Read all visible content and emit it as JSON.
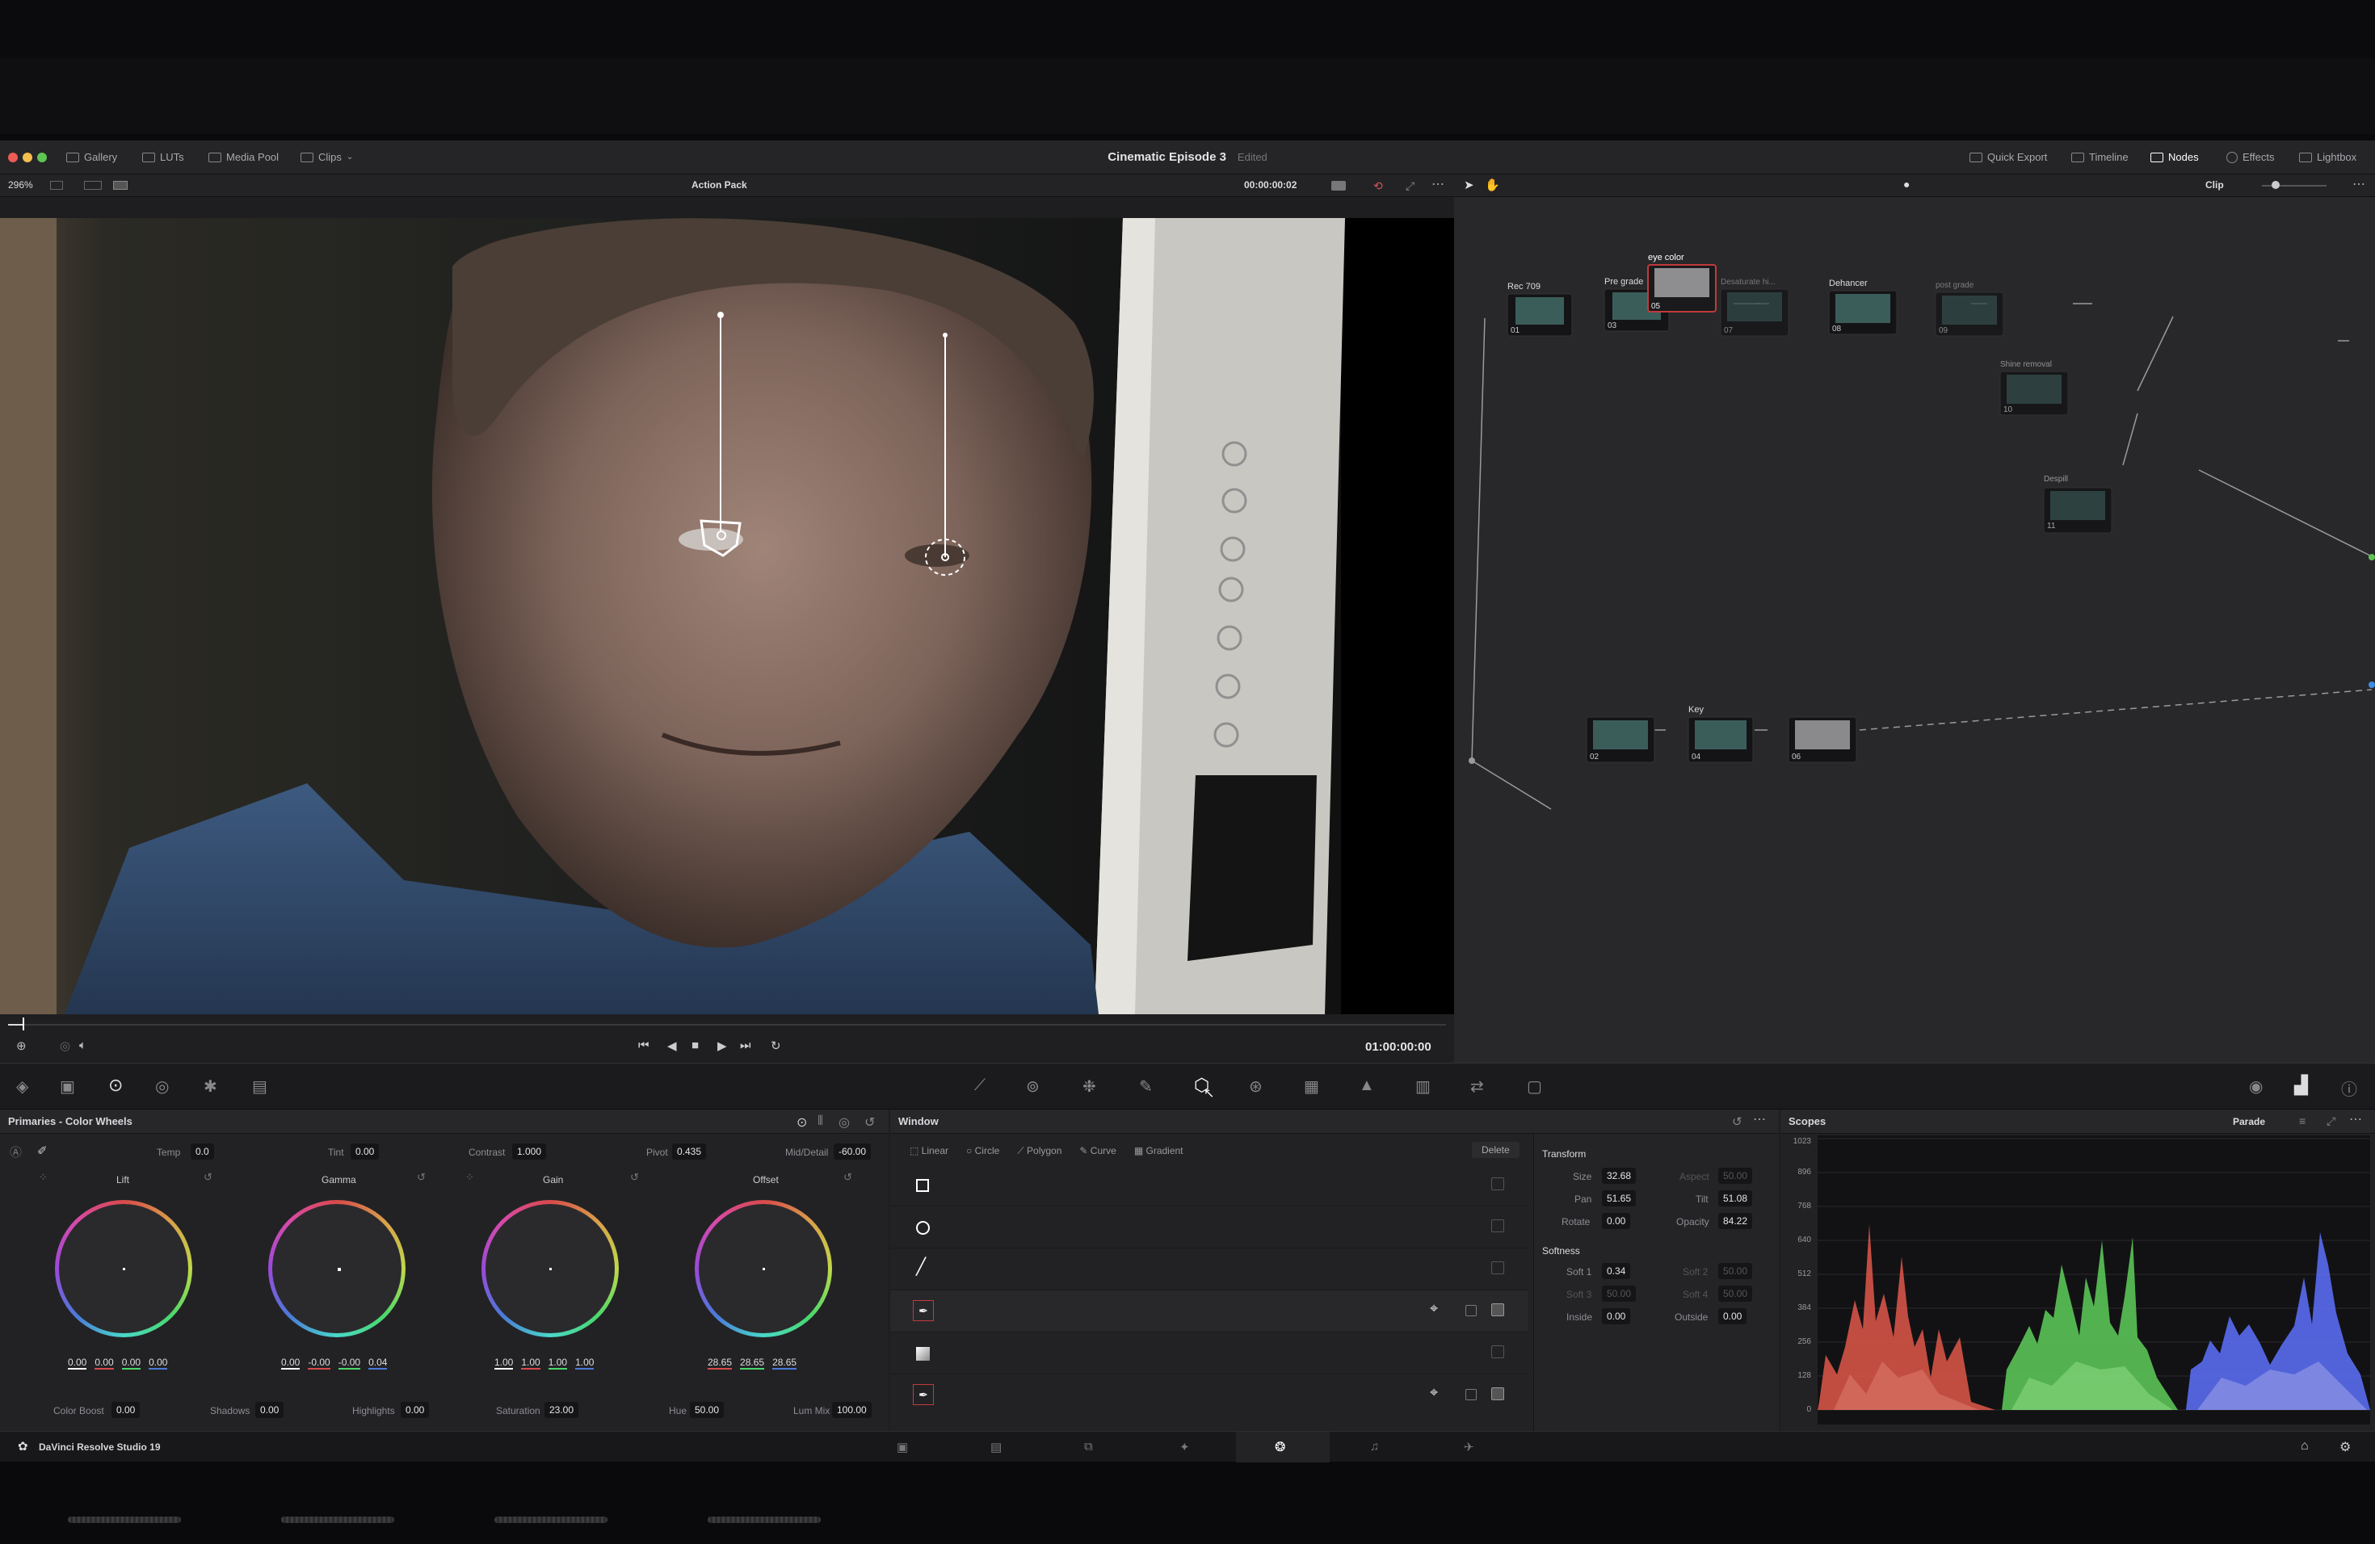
{
  "header": {
    "gallery": "Gallery",
    "luts": "LUTs",
    "media_pool": "Media Pool",
    "clips": "Clips",
    "project_title": "Cinematic Episode 3",
    "edited": "Edited",
    "quick_export": "Quick Export",
    "timeline": "Timeline",
    "nodes": "Nodes",
    "effects": "Effects",
    "lightbox": "Lightbox"
  },
  "viewer_toolbar": {
    "zoom": "296%",
    "preset": "Action Pack",
    "timecode": "00:00:00:02",
    "clip_mode": "Clip"
  },
  "viewer": {
    "timecode": "01:00:00:00",
    "progress": 0.01
  },
  "nodes": [
    {
      "label": "Rec 709",
      "num": "01"
    },
    {
      "label": "Pre grade",
      "num": "03"
    },
    {
      "label": "eye color",
      "num": "05"
    },
    {
      "label": "Desaturate hi...",
      "num": "07"
    },
    {
      "label": "Dehancer",
      "num": "08"
    },
    {
      "label": "post grade",
      "num": "09"
    },
    {
      "label": "Shine removal",
      "num": "10"
    },
    {
      "label": "Despill",
      "num": "11"
    },
    {
      "label": "",
      "num": "02"
    },
    {
      "label": "Key",
      "num": "04"
    },
    {
      "label": "",
      "num": "06"
    }
  ],
  "primaries": {
    "title": "Primaries - Color Wheels",
    "temp_label": "Temp",
    "temp": "0.0",
    "tint_label": "Tint",
    "tint": "0.00",
    "contrast_label": "Contrast",
    "contrast": "1.000",
    "pivot_label": "Pivot",
    "pivot": "0.435",
    "middetail_label": "Mid/Detail",
    "middetail": "-60.00",
    "wheels": [
      {
        "name": "Lift",
        "values": [
          "0.00",
          "0.00",
          "0.00",
          "0.00"
        ]
      },
      {
        "name": "Gamma",
        "values": [
          "0.00",
          "-0.00",
          "-0.00",
          "0.04"
        ]
      },
      {
        "name": "Gain",
        "values": [
          "1.00",
          "1.00",
          "1.00",
          "1.00"
        ]
      },
      {
        "name": "Offset",
        "values": [
          "28.65",
          "28.65",
          "28.65"
        ]
      }
    ],
    "color_boost_label": "Color Boost",
    "color_boost": "0.00",
    "shadows_label": "Shadows",
    "shadows": "0.00",
    "highlights_label": "Highlights",
    "highlights": "0.00",
    "saturation_label": "Saturation",
    "saturation": "23.00",
    "hue_label": "Hue",
    "hue": "50.00",
    "lummix_label": "Lum Mix",
    "lummix": "100.00"
  },
  "window": {
    "title": "Window",
    "linear": "Linear",
    "circle": "Circle",
    "polygon": "Polygon",
    "curve": "Curve",
    "gradient": "Gradient",
    "delete": "Delete",
    "transform_title": "Transform",
    "size_label": "Size",
    "size": "32.68",
    "aspect_label": "Aspect",
    "aspect": "50.00",
    "pan_label": "Pan",
    "pan": "51.65",
    "tilt_label": "Tilt",
    "tilt": "51.08",
    "rotate_label": "Rotate",
    "rotate": "0.00",
    "opacity_label": "Opacity",
    "opacity": "84.22",
    "softness_title": "Softness",
    "soft1_label": "Soft 1",
    "soft1": "0.34",
    "soft2_label": "Soft 2",
    "soft2": "50.00",
    "soft3_label": "Soft 3",
    "soft3": "50.00",
    "soft4_label": "Soft 4",
    "soft4": "50.00",
    "inside_label": "Inside",
    "inside": "0.00",
    "outside_label": "Outside",
    "outside": "0.00"
  },
  "scopes": {
    "title": "Scopes",
    "mode": "Parade",
    "scale": [
      "1023",
      "896",
      "768",
      "640",
      "512",
      "384",
      "256",
      "128",
      "0"
    ]
  },
  "status": {
    "app_name": "DaVinci Resolve Studio 19"
  },
  "colors": {
    "accent": "#e8e8ea",
    "selected_node": "#c23a3a"
  }
}
